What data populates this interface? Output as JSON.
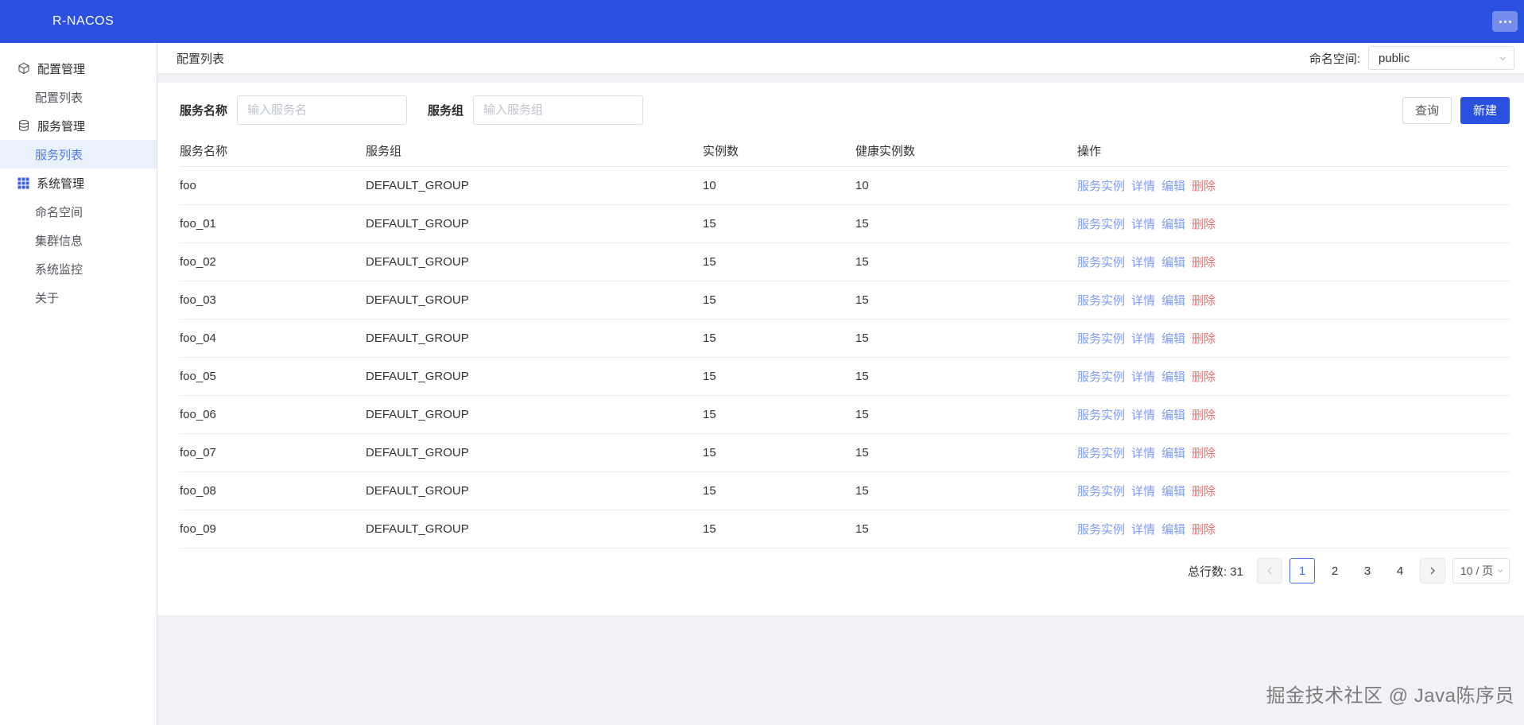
{
  "topbar": {
    "brand": "R-NACOS"
  },
  "sidebar": {
    "items": [
      {
        "label": "配置管理",
        "type": "section",
        "icon": "config-management-icon"
      },
      {
        "label": "配置列表",
        "type": "item"
      },
      {
        "label": "服务管理",
        "type": "section",
        "icon": "service-management-icon"
      },
      {
        "label": "服务列表",
        "type": "item",
        "active": true
      },
      {
        "label": "系统管理",
        "type": "section",
        "icon": "system-management-icon"
      },
      {
        "label": "命名空间",
        "type": "item"
      },
      {
        "label": "集群信息",
        "type": "item"
      },
      {
        "label": "系统监控",
        "type": "item"
      },
      {
        "label": "关于",
        "type": "item"
      }
    ]
  },
  "header": {
    "title": "配置列表",
    "namespace_label": "命名空间:",
    "namespace_value": "public"
  },
  "filters": {
    "name_label": "服务名称",
    "name_placeholder": "输入服务名",
    "group_label": "服务组",
    "group_placeholder": "输入服务组",
    "query_button": "查询",
    "create_button": "新建"
  },
  "table": {
    "columns": [
      "服务名称",
      "服务组",
      "实例数",
      "健康实例数",
      "操作"
    ],
    "actions": {
      "instances": "服务实例",
      "detail": "详情",
      "edit": "编辑",
      "delete": "删除"
    },
    "rows": [
      {
        "name": "foo",
        "group": "DEFAULT_GROUP",
        "instances": "10",
        "healthy": "10"
      },
      {
        "name": "foo_01",
        "group": "DEFAULT_GROUP",
        "instances": "15",
        "healthy": "15"
      },
      {
        "name": "foo_02",
        "group": "DEFAULT_GROUP",
        "instances": "15",
        "healthy": "15"
      },
      {
        "name": "foo_03",
        "group": "DEFAULT_GROUP",
        "instances": "15",
        "healthy": "15"
      },
      {
        "name": "foo_04",
        "group": "DEFAULT_GROUP",
        "instances": "15",
        "healthy": "15"
      },
      {
        "name": "foo_05",
        "group": "DEFAULT_GROUP",
        "instances": "15",
        "healthy": "15"
      },
      {
        "name": "foo_06",
        "group": "DEFAULT_GROUP",
        "instances": "15",
        "healthy": "15"
      },
      {
        "name": "foo_07",
        "group": "DEFAULT_GROUP",
        "instances": "15",
        "healthy": "15"
      },
      {
        "name": "foo_08",
        "group": "DEFAULT_GROUP",
        "instances": "15",
        "healthy": "15"
      },
      {
        "name": "foo_09",
        "group": "DEFAULT_GROUP",
        "instances": "15",
        "healthy": "15"
      }
    ]
  },
  "pagination": {
    "total_label": "总行数: 31",
    "pages": [
      "1",
      "2",
      "3",
      "4"
    ],
    "active_page": "1",
    "page_size": "10 / 页"
  },
  "watermark": "掘金技术社区 @ Java陈序员",
  "colors": {
    "topbar_blue": "#2c50e0",
    "primary_button": "#2b50df",
    "link_blue": "#7e9df3",
    "danger_red": "#e87070",
    "sidebar_active": "#4f7bee",
    "sidebar_active_bg": "#e9f1fd"
  }
}
